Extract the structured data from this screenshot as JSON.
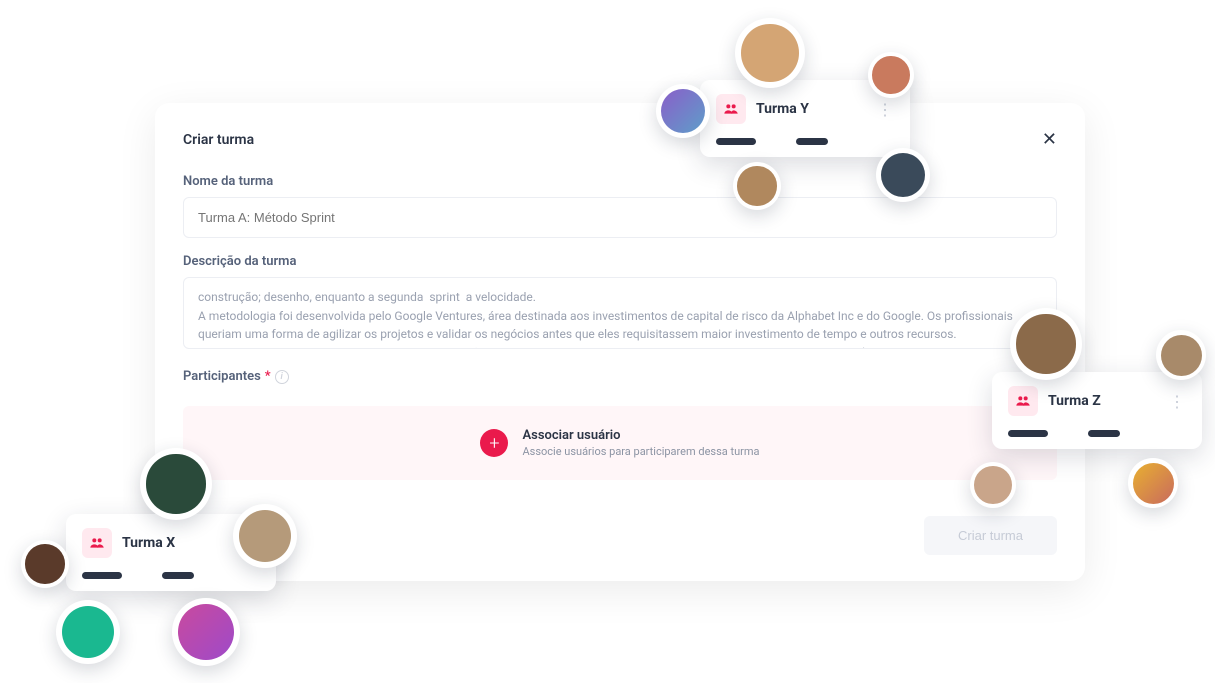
{
  "modal": {
    "title": "Criar turma",
    "name_label": "Nome da turma",
    "name_placeholder": "Turma A: Método Sprint",
    "desc_label": "Descrição  da turma",
    "desc_value": "construção; desenho, enquanto a segunda  sprint  a velocidade.\nA metodologia foi desenvolvida pelo Google Ventures, área destinada aos investimentos de capital de risco da Alphabet Inc e do Google. Os profissionais queriam uma forma de agilizar os projetos e validar os negócios antes que eles requisitassem maior investimento de tempo e outros recursos.\n Sprint é cada um dos ciclos usados para a conclusão de uma parte de um projeto desenvolvido a partir da metodologia ágil (também chamada de",
    "participants_label": "Participantes",
    "required_mark": "*",
    "info_glyph": "i",
    "assoc_title": "Associar usuário",
    "assoc_sub": "Associe usuários para participarem dessa turma",
    "create_label": "Criar turma",
    "close_glyph": "✕",
    "plus_glyph": "+"
  },
  "cards": {
    "y": {
      "title": "Turma Y",
      "dots": "⋮"
    },
    "z": {
      "title": "Turma Z",
      "dots": "⋮"
    },
    "x": {
      "title": "Turma X",
      "dots": "⋮"
    }
  },
  "colors": {
    "accent": "#ea1a4c"
  }
}
